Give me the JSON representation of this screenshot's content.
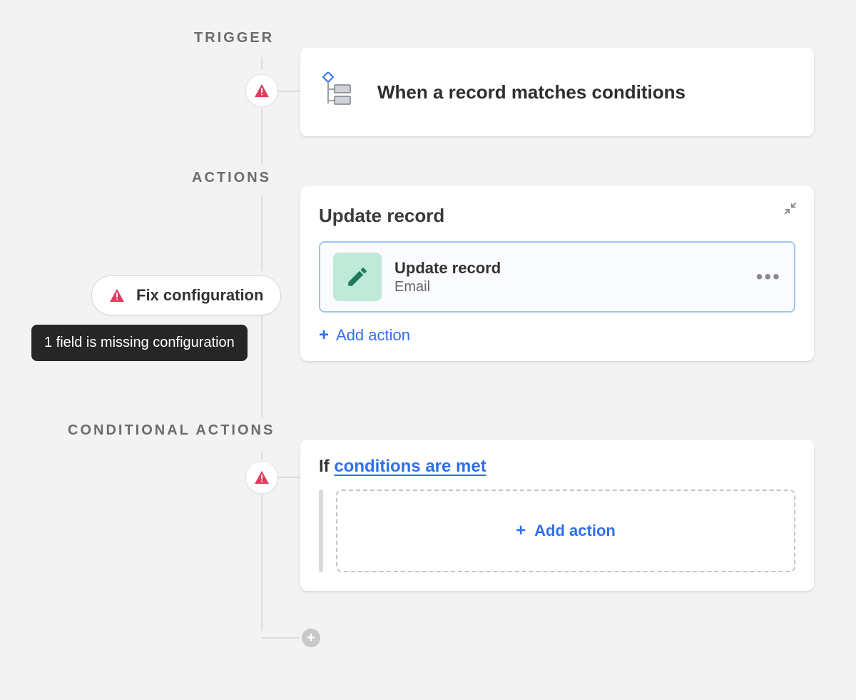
{
  "labels": {
    "trigger": "TRIGGER",
    "actions": "ACTIONS",
    "conditional": "CONDITIONAL ACTIONS"
  },
  "trigger": {
    "title": "When a record matches conditions"
  },
  "fix": {
    "button": "Fix configuration",
    "tooltip": "1 field is missing configuration"
  },
  "actionsCard": {
    "title": "Update record",
    "row": {
      "title": "Update record",
      "subtitle": "Email"
    },
    "addAction": "Add action"
  },
  "conditional": {
    "ifPrefix": "If ",
    "linkText": "conditions are met",
    "addAction": "Add action"
  },
  "colors": {
    "warn": "#df3d5e",
    "blue": "#2e6ff1",
    "mint": "#bfe9d8"
  }
}
